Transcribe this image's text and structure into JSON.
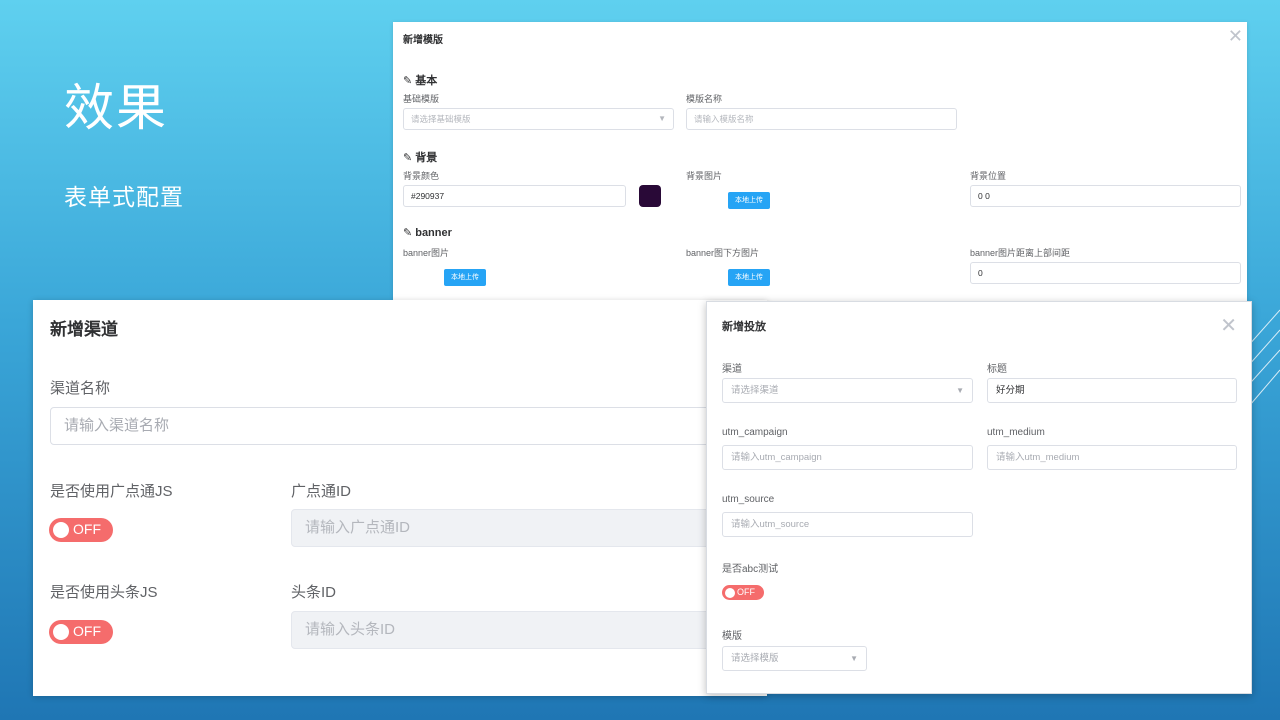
{
  "slide": {
    "title": "效果",
    "subtitle": "表单式配置"
  },
  "template_dialog": {
    "title": "新增模版",
    "close_icon": "close-icon",
    "sections": {
      "basic": "基本",
      "background": "背景",
      "banner": "banner"
    },
    "fields": {
      "base_template_label": "基础模版",
      "base_template_placeholder": "请选择基础模版",
      "template_name_label": "模版名称",
      "template_name_placeholder": "请输入模版名称",
      "bg_color_label": "背景颜色",
      "bg_color_value": "#290937",
      "bg_image_label": "背景图片",
      "bg_position_label": "背景位置",
      "bg_position_value": "0 0",
      "banner_image_label": "banner图片",
      "banner_below_label": "banner图下方图片",
      "banner_top_gap_label": "banner图片距离上部间距",
      "banner_top_gap_value": "0"
    },
    "upload_label": "本地上传"
  },
  "channel_dialog": {
    "title": "新增渠道",
    "channel_name_label": "渠道名称",
    "channel_name_placeholder": "请输入渠道名称",
    "gdt_js_label": "是否使用广点通JS",
    "gdt_toggle": "OFF",
    "gdt_id_label": "广点通ID",
    "gdt_id_placeholder": "请输入广点通ID",
    "toutiao_js_label": "是否使用头条JS",
    "toutiao_toggle": "OFF",
    "toutiao_id_label": "头条ID",
    "toutiao_id_placeholder": "请输入头条ID"
  },
  "placement_dialog": {
    "title": "新增投放",
    "close_icon": "close-icon",
    "channel_label": "渠道",
    "channel_placeholder": "请选择渠道",
    "title_label": "标题",
    "title_value": "好分期",
    "utm_campaign_label": "utm_campaign",
    "utm_campaign_placeholder": "请输入utm_campaign",
    "utm_medium_label": "utm_medium",
    "utm_medium_placeholder": "请输入utm_medium",
    "utm_source_label": "utm_source",
    "utm_source_placeholder": "请输入utm_source",
    "abc_test_label": "是否abc测试",
    "abc_toggle": "OFF",
    "template_label": "模版",
    "template_placeholder": "请选择模版"
  },
  "colors": {
    "swatch": "#290937",
    "toggle_off": "#f56c6c",
    "upload_button": "#26a4f5"
  }
}
